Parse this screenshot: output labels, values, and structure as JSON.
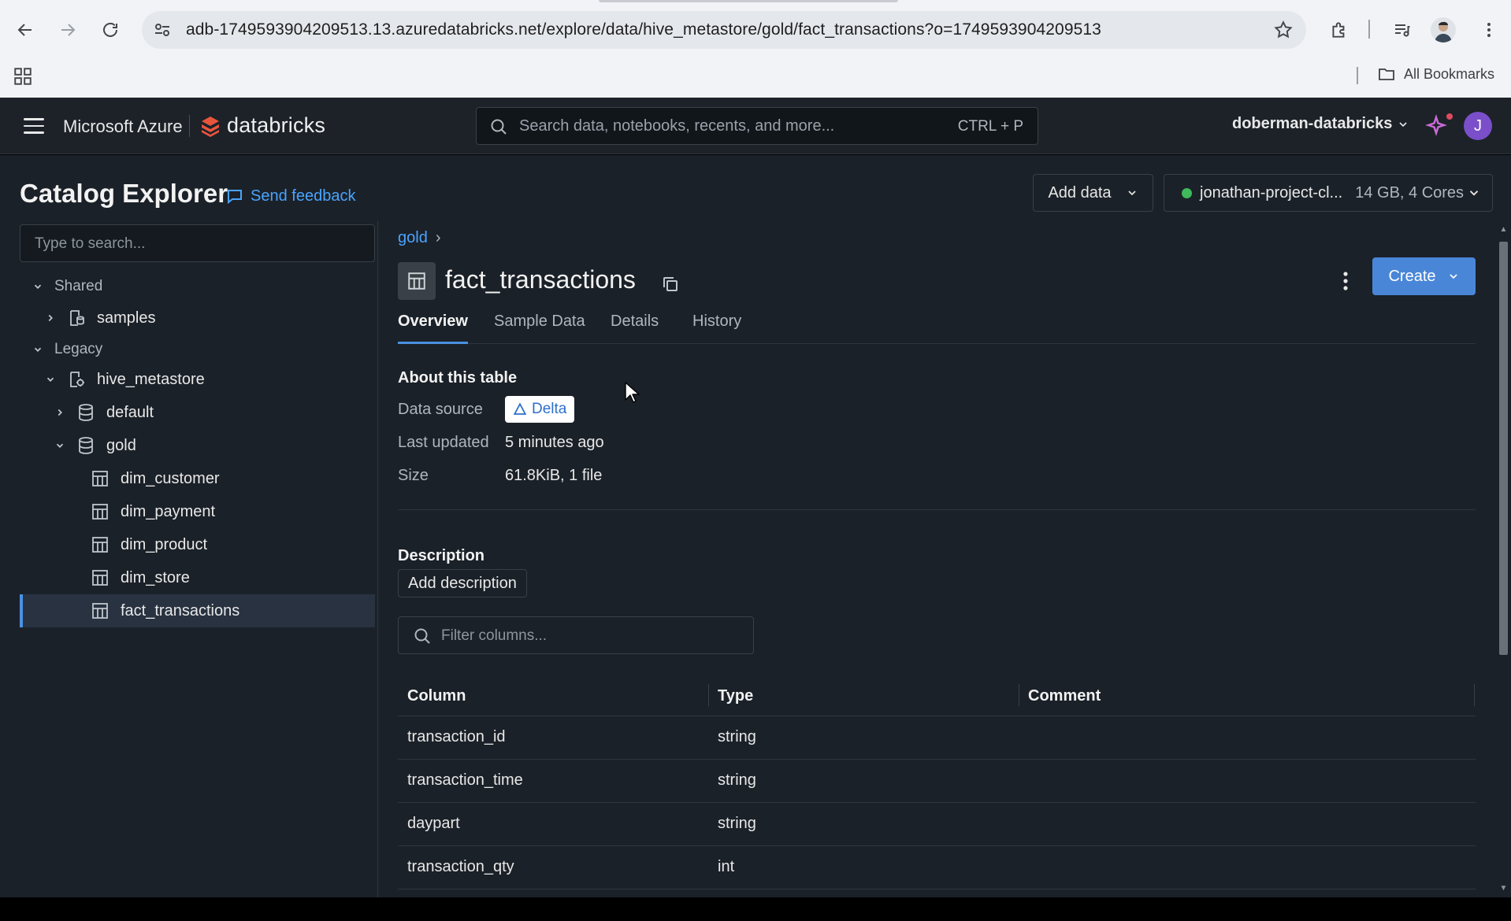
{
  "browser": {
    "url": "adb-1749593904209513.13.azuredatabricks.net/explore/data/hive_metastore/gold/fact_transactions?o=1749593904209513",
    "bookmarks_label": "All Bookmarks"
  },
  "topbar": {
    "brand_azure": "Microsoft Azure",
    "brand_product": "databricks",
    "search_placeholder": "Search data, notebooks, recents, and more...",
    "search_shortcut": "CTRL + P",
    "workspace": "doberman-databricks",
    "user_initial": "J"
  },
  "page": {
    "title": "Catalog Explorer",
    "feedback": "Send feedback",
    "add_data": "Add data",
    "compute_name": "jonathan-project-cl...",
    "compute_meta": "14 GB, 4 Cores"
  },
  "tree": {
    "search_placeholder": "Type to search...",
    "items": [
      {
        "label": "Shared"
      },
      {
        "label": "samples"
      },
      {
        "label": "Legacy"
      },
      {
        "label": "hive_metastore"
      },
      {
        "label": "default"
      },
      {
        "label": "gold"
      },
      {
        "label": "dim_customer"
      },
      {
        "label": "dim_payment"
      },
      {
        "label": "dim_product"
      },
      {
        "label": "dim_store"
      },
      {
        "label": "fact_transactions"
      }
    ]
  },
  "detail": {
    "breadcrumb": "gold",
    "breadcrumb_sep": "›",
    "table_name": "fact_transactions",
    "create_label": "Create",
    "tabs": [
      {
        "label": "Overview"
      },
      {
        "label": "Sample Data"
      },
      {
        "label": "Details"
      },
      {
        "label": "History"
      }
    ],
    "about_heading": "About this table",
    "data_source_label": "Data source",
    "data_source_value": "Delta",
    "last_updated_label": "Last updated",
    "last_updated_value": "5 minutes ago",
    "size_label": "Size",
    "size_value": "61.8KiB, 1 file",
    "description_heading": "Description",
    "add_description": "Add description",
    "filter_placeholder": "Filter columns...",
    "columns_header": {
      "column": "Column",
      "type": "Type",
      "comment": "Comment"
    },
    "columns": [
      {
        "name": "transaction_id",
        "type": "string"
      },
      {
        "name": "transaction_time",
        "type": "string"
      },
      {
        "name": "daypart",
        "type": "string"
      },
      {
        "name": "transaction_qty",
        "type": "int"
      }
    ]
  }
}
